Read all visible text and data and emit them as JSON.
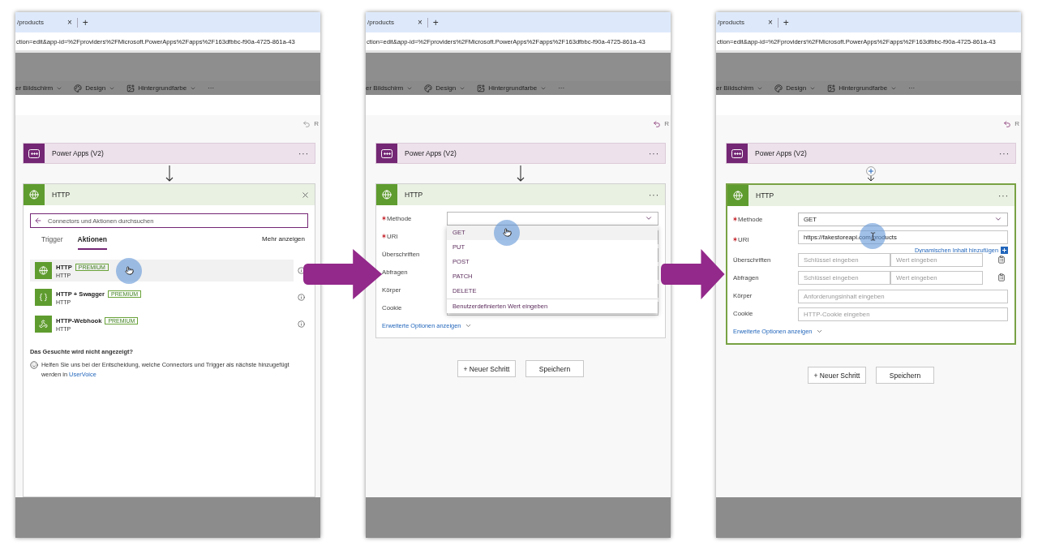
{
  "panels": [
    {
      "browser": {
        "tab_title": "/products",
        "tab_close": "×",
        "new_tab": "+",
        "url": "ction=edit&app-id=%2Fproviders%2FMicrosoft.PowerApps%2Fapps%2F163dfbbc-f90a-4725-861a-43"
      },
      "toolbar": [
        {
          "kind": "menu",
          "label": "er Bildschirm"
        },
        {
          "kind": "palette",
          "label": "Design"
        },
        {
          "kind": "fill",
          "label": "Hintergrundfarbe"
        },
        {
          "kind": "overflow",
          "label": "···"
        }
      ],
      "undo_label": "R",
      "trigger": {
        "title": "Power Apps (V2)",
        "menu": "···"
      },
      "connector": {
        "kind": "arrow"
      },
      "action": {
        "title": "HTTP",
        "selected": false,
        "header_button": {
          "kind": "close"
        },
        "body": {
          "kind": "picker",
          "search_placeholder": "Connectors und Aktionen durchsuchen",
          "tabs": [
            {
              "label": "Trigger",
              "selected": false
            },
            {
              "label": "Aktionen",
              "selected": true
            }
          ],
          "more_link": "Mehr anzeigen",
          "results": [
            {
              "kind": "globe",
              "title": "HTTP",
              "badge": "PREMIUM",
              "subtitle": "HTTP",
              "hovered": true,
              "hand_pointer": true
            },
            {
              "kind": "braces",
              "title": "HTTP + Swagger",
              "badge": "PREMIUM",
              "subtitle": "HTTP",
              "hovered": false
            },
            {
              "kind": "webhook",
              "title": "HTTP-Webhook",
              "badge": "PREMIUM",
              "subtitle": "HTTP",
              "hovered": false
            }
          ],
          "footer_title": "Das Gesuchte wird nicht angezeigt?",
          "footer_text": "Helfen Sie uns bei der Entscheidung, welche Connectors und Trigger als nächste hinzugefügt werden in",
          "footer_link": "UserVoice"
        }
      }
    },
    {
      "browser": {
        "tab_title": "/products",
        "tab_close": "×",
        "new_tab": "+",
        "url": "ction=edit&app-id=%2Fproviders%2FMicrosoft.PowerApps%2Fapps%2F163dfbbc-f90a-4725-861a-43"
      },
      "toolbar": [
        {
          "kind": "menu",
          "label": "er Bildschirm"
        },
        {
          "kind": "palette",
          "label": "Design"
        },
        {
          "kind": "fill",
          "label": "Hintergrundfarbe"
        },
        {
          "kind": "overflow",
          "label": "···"
        }
      ],
      "undo_label": "R",
      "trigger": {
        "title": "Power Apps (V2)",
        "menu": "···"
      },
      "connector": {
        "kind": "arrow"
      },
      "action": {
        "title": "HTTP",
        "selected": false,
        "header_button": {
          "kind": "more",
          "label": "···"
        },
        "body": {
          "kind": "form",
          "fields": [
            {
              "kind": "select",
              "label": "Methode",
              "required": true,
              "open": true,
              "options": [
                {
                  "label": "GET",
                  "hovered": true,
                  "hand_pointer": true
                },
                {
                  "label": "PUT",
                  "hovered": false
                },
                {
                  "label": "POST",
                  "hovered": false
                },
                {
                  "label": "PATCH",
                  "hovered": false
                },
                {
                  "label": "DELETE",
                  "hovered": false
                }
              ],
              "custom_option": "Benutzerdefinierten Wert eingeben"
            },
            {
              "kind": "text",
              "label": "URI",
              "required": true
            },
            {
              "kind": "text",
              "label": "Überschriften",
              "required": false
            },
            {
              "kind": "text",
              "label": "Abfragen",
              "required": false
            },
            {
              "kind": "text",
              "label": "Körper",
              "required": false
            },
            {
              "kind": "text",
              "label": "Cookie",
              "required": false
            }
          ],
          "advanced_link": "Erweiterte Optionen anzeigen"
        }
      },
      "buttons": [
        "+ Neuer Schritt",
        "Speichern"
      ]
    },
    {
      "browser": {
        "tab_title": "/products",
        "tab_close": "×",
        "new_tab": "+",
        "url": "ction=edit&app-id=%2Fproviders%2FMicrosoft.PowerApps%2Fapps%2F163dfbbc-f90a-4725-861a-43"
      },
      "toolbar": [
        {
          "kind": "menu",
          "label": "er Bildschirm"
        },
        {
          "kind": "palette",
          "label": "Design"
        },
        {
          "kind": "fill",
          "label": "Hintergrundfarbe"
        },
        {
          "kind": "overflow",
          "label": "···"
        }
      ],
      "undo_label": "R",
      "trigger": {
        "title": "Power Apps (V2)",
        "menu": "···"
      },
      "connector": {
        "kind": "insert"
      },
      "action": {
        "title": "HTTP",
        "selected": true,
        "header_button": {
          "kind": "more",
          "label": "···"
        },
        "body": {
          "kind": "form",
          "fields": [
            {
              "kind": "select",
              "label": "Methode",
              "required": true,
              "open": false,
              "value": "GET"
            },
            {
              "kind": "text",
              "label": "URI",
              "required": true,
              "value": "https://fakestoreapi.com/products",
              "text_pointer": true,
              "dynamic_link": "Dynamischen Inhalt hinzufügen"
            },
            {
              "kind": "pair",
              "label": "Überschriften",
              "required": false,
              "key_placeholder": "Schlüssel eingeben",
              "value_placeholder": "Wert eingeben"
            },
            {
              "kind": "pair",
              "label": "Abfragen",
              "required": false,
              "key_placeholder": "Schlüssel eingeben",
              "value_placeholder": "Wert eingeben"
            },
            {
              "kind": "text",
              "label": "Körper",
              "required": false,
              "placeholder": "Anforderungsinhalt eingeben"
            },
            {
              "kind": "text",
              "label": "Cookie",
              "required": false,
              "placeholder": "HTTP-Cookie eingeben"
            }
          ],
          "advanced_link": "Erweiterte Optionen anzeigen"
        }
      },
      "buttons": [
        "+ Neuer Schritt",
        "Speichern"
      ]
    }
  ],
  "transitions": [
    {
      "kind": "arrow"
    },
    {
      "kind": "arrow"
    }
  ]
}
